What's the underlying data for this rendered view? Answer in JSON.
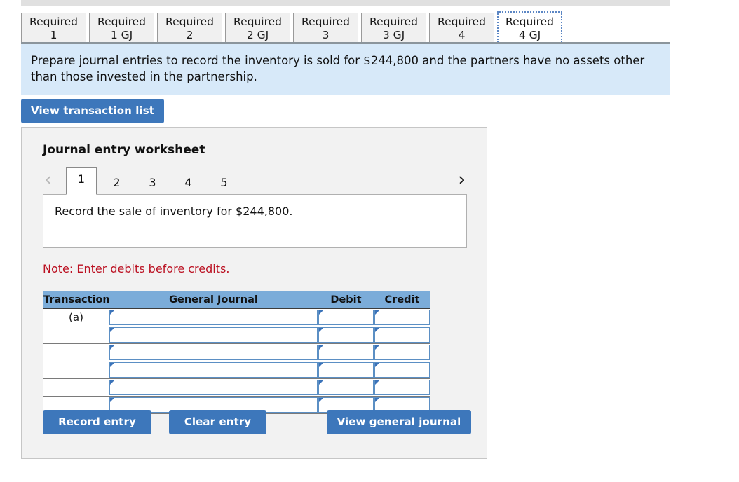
{
  "tabs": [
    {
      "label": "Required\n1",
      "active": false
    },
    {
      "label": "Required\n1 GJ",
      "active": false
    },
    {
      "label": "Required\n2",
      "active": false
    },
    {
      "label": "Required\n2 GJ",
      "active": false
    },
    {
      "label": "Required\n3",
      "active": false
    },
    {
      "label": "Required\n3 GJ",
      "active": false
    },
    {
      "label": "Required\n4",
      "active": false
    },
    {
      "label": "Required\n4 GJ",
      "active": true
    }
  ],
  "instructions": {
    "text": "Prepare journal entries to record the inventory is sold for $244,800 and the partners have no assets other than those invested in the partnership.",
    "background": "#d7e9f9"
  },
  "view_transaction_list_button": "View transaction list",
  "worksheet": {
    "title": "Journal entry worksheet",
    "pager": {
      "prev_icon": "chevron-left",
      "next_icon": "chevron-right",
      "pages": [
        "1",
        "2",
        "3",
        "4",
        "5"
      ],
      "active_page": "1",
      "prev_enabled": false,
      "next_enabled": true
    },
    "description": "Record the sale of inventory for $244,800.",
    "note": "Note: Enter debits before credits.",
    "table": {
      "headers": [
        "Transaction",
        "General Journal",
        "Debit",
        "Credit"
      ],
      "header_color": "#7bacd9",
      "rows": [
        {
          "transaction": "(a)",
          "general_journal": "",
          "debit": "",
          "credit": ""
        },
        {
          "transaction": "",
          "general_journal": "",
          "debit": "",
          "credit": ""
        },
        {
          "transaction": "",
          "general_journal": "",
          "debit": "",
          "credit": ""
        },
        {
          "transaction": "",
          "general_journal": "",
          "debit": "",
          "credit": ""
        },
        {
          "transaction": "",
          "general_journal": "",
          "debit": "",
          "credit": ""
        },
        {
          "transaction": "",
          "general_journal": "",
          "debit": "",
          "credit": ""
        }
      ]
    },
    "buttons": {
      "record_entry": "Record entry",
      "clear_entry": "Clear entry",
      "view_general_journal": "View general journal"
    }
  },
  "colors": {
    "button_blue": "#3d77bb",
    "note_red": "#bb1122",
    "panel_gray": "#f2f2f2",
    "tab_gray": "#f0f0f0"
  }
}
